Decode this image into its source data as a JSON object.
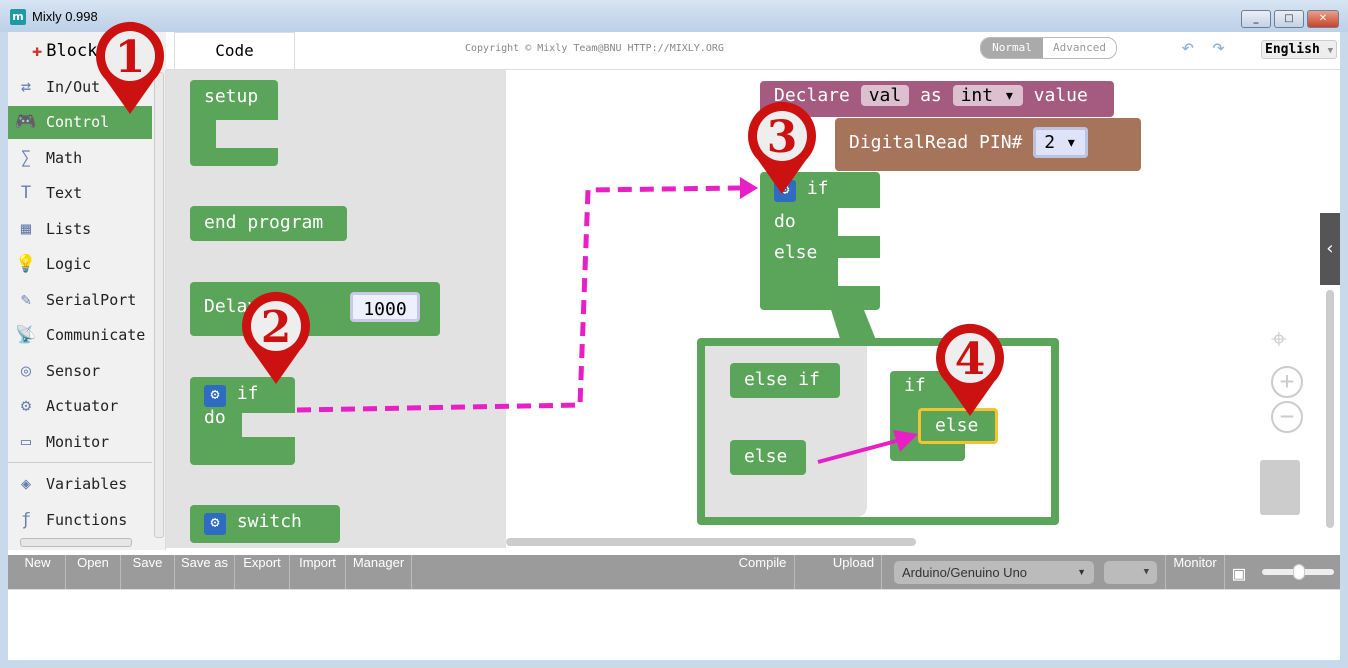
{
  "window": {
    "title": "Mixly 0.998",
    "app_icon": "m"
  },
  "tabs": {
    "blocks": "Blocks",
    "code": "Code"
  },
  "copyright": "Copyright © Mixly Team@BNU HTTP://MIXLY.ORG",
  "mode": {
    "normal": "Normal",
    "advanced": "Advanced",
    "selected": "Normal"
  },
  "language": "English",
  "sidebar": {
    "items": [
      {
        "label": "In/Out",
        "icon": "arrows-icon"
      },
      {
        "label": "Control",
        "icon": "gamepad-icon",
        "selected": true
      },
      {
        "label": "Math",
        "icon": "math-icon"
      },
      {
        "label": "Text",
        "icon": "text-icon"
      },
      {
        "label": "Lists",
        "icon": "lists-icon"
      },
      {
        "label": "Logic",
        "icon": "bulb-icon"
      },
      {
        "label": "SerialPort",
        "icon": "serial-icon"
      },
      {
        "label": "Communicate",
        "icon": "satellite-icon"
      },
      {
        "label": "Sensor",
        "icon": "sensor-icon"
      },
      {
        "label": "Actuator",
        "icon": "actuator-icon"
      },
      {
        "label": "Monitor",
        "icon": "monitor-icon"
      },
      {
        "label": "Variables",
        "icon": "variables-icon"
      },
      {
        "label": "Functions",
        "icon": "functions-icon"
      }
    ]
  },
  "flyout": {
    "setup": "setup",
    "end_program": "end program",
    "delay": "Delay",
    "delay_value": "1000",
    "if": "if",
    "do": "do",
    "switch": "switch"
  },
  "workspace": {
    "declare": "Declare",
    "var": "val",
    "as": "as",
    "type": "int",
    "value": "value",
    "digitalread": "DigitalRead PIN#",
    "pin": "2",
    "if": "if",
    "do": "do",
    "else": "else"
  },
  "mutator": {
    "else_if": "else if",
    "else": "else",
    "if": "if",
    "inner_else": "else"
  },
  "markers": [
    "1",
    "2",
    "3",
    "4"
  ],
  "toolbar": {
    "new": "New",
    "open": "Open",
    "save": "Save",
    "save_as": "Save as",
    "export": "Export",
    "import": "Import",
    "manager": "Manager",
    "compile": "Compile",
    "upload": "Upload",
    "board": "Arduino/Genuino Uno",
    "port": "",
    "monitor": "Monitor"
  },
  "colors": {
    "control": "#5ba55b",
    "variables": "#a55b80",
    "io": "#a5745b",
    "arrow": "#e81fc5",
    "marker": "#cc1111"
  }
}
